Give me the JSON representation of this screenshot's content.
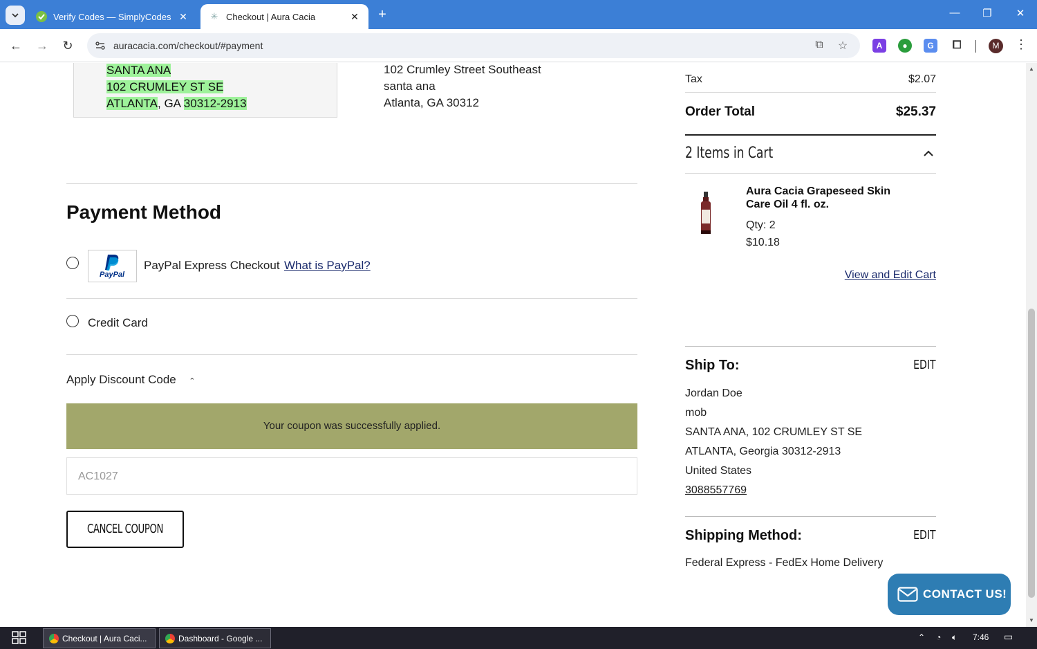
{
  "browser": {
    "tabs": [
      {
        "title": "Verify Codes — SimplyCodes",
        "active": false
      },
      {
        "title": "Checkout | Aura Cacia",
        "active": true
      }
    ],
    "url": "auracacia.com/checkout/#payment",
    "profile_initial": "M"
  },
  "billing_address": {
    "lines": [
      "SANTA ANA",
      "102 CRUMLEY ST SE"
    ],
    "city": "ATLANTA",
    "state_sep": ", GA ",
    "zip": "30312-2913"
  },
  "entered_address": {
    "lines": [
      "102 Crumley Street Southeast",
      "santa ana",
      "Atlanta, GA 30312"
    ]
  },
  "payment": {
    "title": "Payment Method",
    "paypal_label": "PayPal Express Checkout",
    "paypal_link": "What is PayPal?",
    "paypal_logo_text": "PayPal",
    "credit_card_label": "Credit Card",
    "discount_toggle": "Apply Discount Code",
    "coupon_message": "Your coupon was successfully applied.",
    "coupon_code": "AC1027",
    "cancel_coupon": "CANCEL COUPON"
  },
  "summary": {
    "tax_label": "Tax",
    "tax_value": "$2.07",
    "total_label": "Order Total",
    "total_value": "$25.37",
    "cart_heading": "2 Items in Cart",
    "product": {
      "name": "Aura Cacia Grapeseed Skin Care Oil 4 fl. oz.",
      "qty": "Qty: 2",
      "price": "$10.18"
    },
    "view_edit_cart": "View and Edit Cart"
  },
  "ship_to": {
    "heading": "Ship To:",
    "edit": "EDIT",
    "lines": [
      "Jordan Doe",
      "mob",
      "SANTA ANA, 102 CRUMLEY ST SE",
      "ATLANTA, Georgia 30312-2913",
      "United States"
    ],
    "phone": "3088557769"
  },
  "shipping_method": {
    "heading": "Shipping Method:",
    "edit": "EDIT",
    "value": "Federal Express - FedEx Home Delivery"
  },
  "contact_button": "CONTACT US!",
  "taskbar": {
    "items": [
      "Checkout | Aura Caci...",
      "Dashboard - Google ..."
    ],
    "time": "7:46"
  },
  "colors": {
    "chrome_blue": "#3c7fd6",
    "coupon_banner": "#a2a76b",
    "address_highlight": "#9ef29a",
    "contact_blue": "#2e7db3"
  }
}
